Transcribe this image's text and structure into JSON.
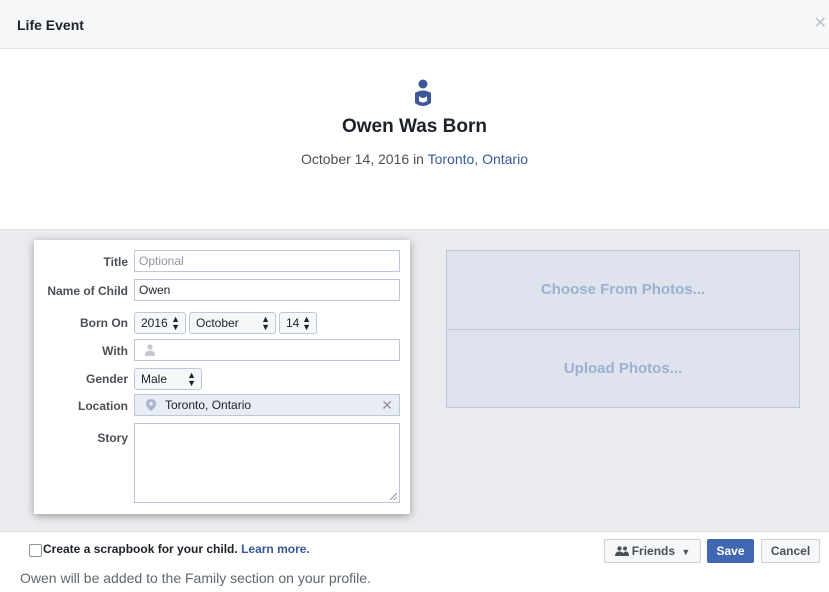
{
  "dialog": {
    "title": "Life Event",
    "close_icon": "close-icon"
  },
  "event": {
    "icon": "baby-icon",
    "title": "Owen Was Born",
    "date_text": "October 14, 2016",
    "in_text": "in",
    "location_link": "Toronto, Ontario"
  },
  "form": {
    "title": {
      "label": "Title",
      "placeholder": "Optional"
    },
    "child_name": {
      "label": "Name of Child",
      "value": "Owen"
    },
    "born_on": {
      "label": "Born On",
      "year": "2016",
      "month": "October",
      "day": "14"
    },
    "with": {
      "label": "With",
      "icon": "person-icon"
    },
    "gender": {
      "label": "Gender",
      "value": "Male"
    },
    "location": {
      "label": "Location",
      "value": "Toronto, Ontario",
      "icon": "location-pin-icon"
    },
    "story": {
      "label": "Story"
    }
  },
  "photos": {
    "choose": "Choose From Photos...",
    "upload": "Upload Photos..."
  },
  "footer": {
    "scrapbook_label": "Create a scrapbook for your child.",
    "learn_more": "Learn more.",
    "note": "Owen will be added to the Family section on your profile.",
    "privacy": "Friends",
    "save": "Save",
    "cancel": "Cancel"
  },
  "colors": {
    "accent": "#4267b2",
    "link": "#365899",
    "icon": "#3b5998"
  }
}
